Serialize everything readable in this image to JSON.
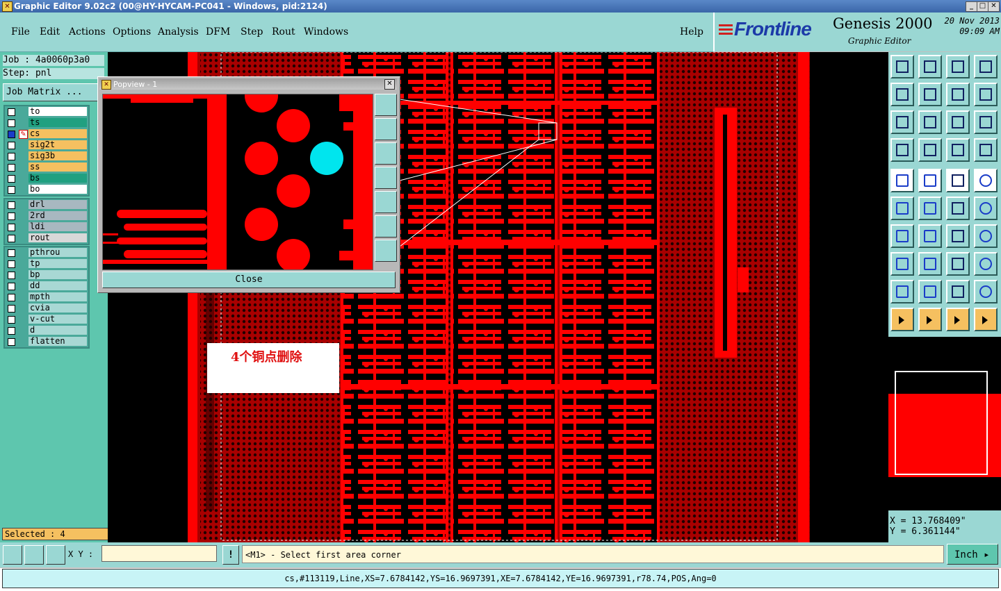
{
  "window": {
    "title": "Graphic Editor 9.02c2 (00@HY-HYCAM-PC041 - Windows, pid:2124)"
  },
  "menu": [
    "File",
    "Edit",
    "Actions",
    "Options",
    "Analysis",
    "DFM",
    "Step",
    "Rout",
    "Windows"
  ],
  "help": "Help",
  "brand": {
    "logo": "Frontline",
    "product": "Genesis 2000",
    "subtitle": "Graphic Editor",
    "date": "20 Nov 2013",
    "time": "09:09 AM"
  },
  "job": {
    "job_label": "Job : 4a0060p3a0",
    "step_label": "Step: pnl",
    "matrix_button": "Job Matrix ..."
  },
  "layer_groups": [
    {
      "layers": [
        {
          "name": "to",
          "color": "#ffffff"
        },
        {
          "name": "ts",
          "color": "#20a080"
        },
        {
          "name": "cs",
          "color": "#f5c060",
          "active": true
        },
        {
          "name": "sig2t",
          "color": "#f5c060"
        },
        {
          "name": "sig3b",
          "color": "#f5c060"
        },
        {
          "name": "ss",
          "color": "#f5c060"
        },
        {
          "name": "bs",
          "color": "#20a080"
        },
        {
          "name": "bo",
          "color": "#ffffff"
        }
      ]
    },
    {
      "layers": [
        {
          "name": "drl",
          "color": "#a8b8c0"
        },
        {
          "name": "2rd",
          "color": "#a8b8c0"
        },
        {
          "name": "ldi",
          "color": "#a8b8c0"
        },
        {
          "name": "rout",
          "color": "#d8d8d8"
        }
      ]
    },
    {
      "layers": [
        {
          "name": "pthrou",
          "color": "#a8d8d4"
        },
        {
          "name": "tp",
          "color": "#a8d8d4"
        },
        {
          "name": "bp",
          "color": "#a8d8d4"
        },
        {
          "name": "dd",
          "color": "#a8d8d4"
        },
        {
          "name": "mpth",
          "color": "#a8d8d4"
        },
        {
          "name": "cvia",
          "color": "#a8d8d4"
        },
        {
          "name": "v-cut",
          "color": "#a8d8d4"
        },
        {
          "name": "d",
          "color": "#a8d8d4"
        },
        {
          "name": "flatten",
          "color": "#a8d8d4"
        }
      ]
    }
  ],
  "selected": "Selected : 4",
  "popview": {
    "title": "Popview - 1",
    "close_label": "Close"
  },
  "annotation": "4个铜点删除",
  "coords": {
    "x": "X =  13.768409\"",
    "y": "Y =  6.361144\""
  },
  "bottom": {
    "xy_label": "X Y :",
    "xy_value": "",
    "bang": "!",
    "prompt": "<M1> - Select first area corner",
    "units": "Inch"
  },
  "status": "cs,#113119,Line,XS=7.6784142,YS=16.9697391,XE=7.6784142,YE=16.9697391,r78.74,POS,Ang=0",
  "colors": {
    "copper": "#ff0000",
    "selection": "#00e5ee",
    "panel": "#9ad7d3",
    "side": "#5ec6ae"
  }
}
